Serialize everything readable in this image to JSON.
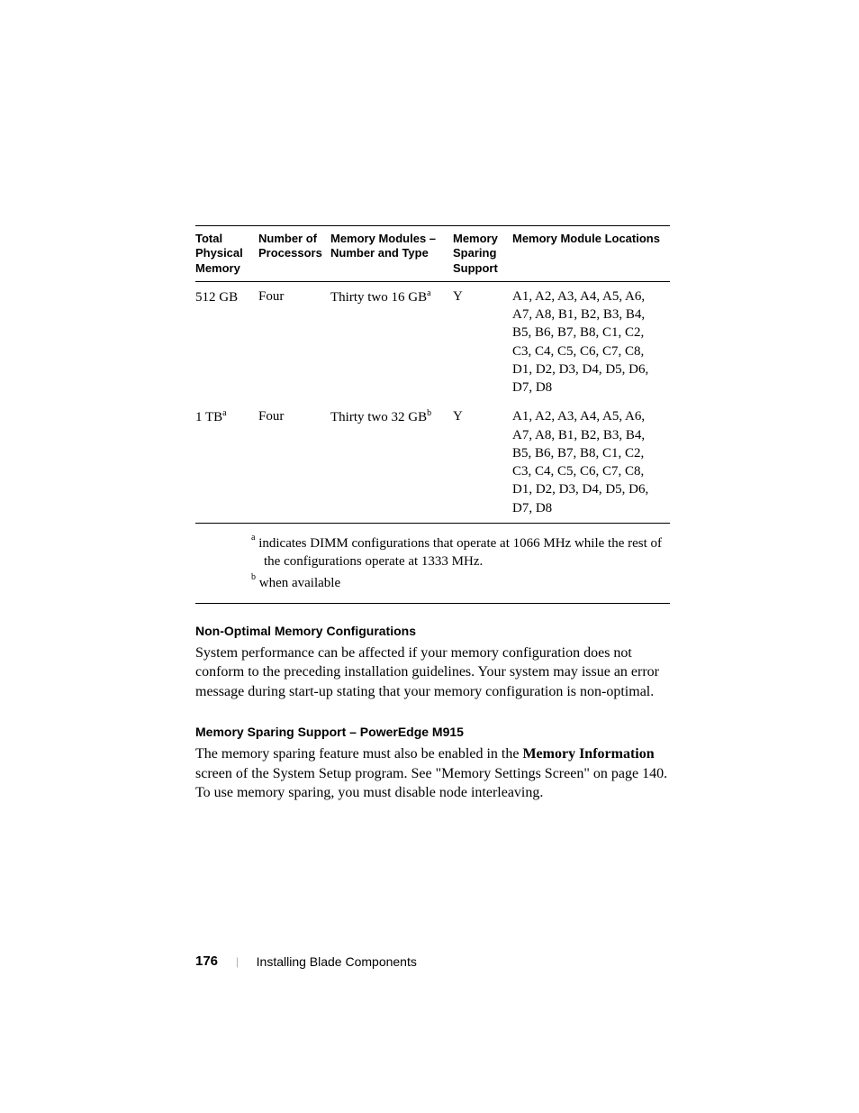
{
  "table": {
    "headers": {
      "col1": "Total Physical Memory",
      "col2": "Number of Processors",
      "col3": "Memory Modules – Number and Type",
      "col4": "Memory Sparing Support",
      "col5": "Memory Module Locations"
    },
    "rows": [
      {
        "mem": "512 GB",
        "mem_sup": "",
        "procs": "Four",
        "modules": "Thirty two 16 GB",
        "modules_sup": "a",
        "sparing": "Y",
        "locations": "A1, A2, A3, A4, A5, A6, A7, A8, B1, B2, B3, B4, B5, B6, B7, B8, C1, C2, C3, C4, C5, C6, C7, C8, D1, D2, D3, D4, D5, D6, D7, D8"
      },
      {
        "mem": "1 TB",
        "mem_sup": "a",
        "procs": "Four",
        "modules": "Thirty two 32 GB",
        "modules_sup": "b",
        "sparing": "Y",
        "locations": "A1, A2, A3, A4, A5, A6, A7, A8, B1, B2, B3, B4, B5, B6, B7, B8, C1, C2, C3, C4, C5, C6, C7, C8, D1, D2, D3, D4, D5, D6, D7, D8"
      }
    ],
    "footnotes": {
      "a_sup": "a",
      "a_text": "indicates DIMM configurations that operate at 1066 MHz while the rest of the configurations operate at 1333 MHz.",
      "b_sup": "b",
      "b_text": "when available"
    }
  },
  "section1": {
    "heading": "Non-Optimal Memory Configurations",
    "body": "System performance can be affected if your memory configuration does not conform to the preceding installation guidelines. Your system may issue an error message during start-up stating that your memory configuration is non-optimal."
  },
  "section2": {
    "heading": "Memory Sparing Support – PowerEdge M915",
    "body_pre": "The memory sparing feature must also be enabled in the ",
    "body_bold": "Memory Information",
    "body_post": " screen of the System Setup program. See \"Memory Settings Screen\" on page 140. To use memory sparing, you must disable node interleaving."
  },
  "footer": {
    "page": "176",
    "sep": "|",
    "title": "Installing Blade Components"
  }
}
